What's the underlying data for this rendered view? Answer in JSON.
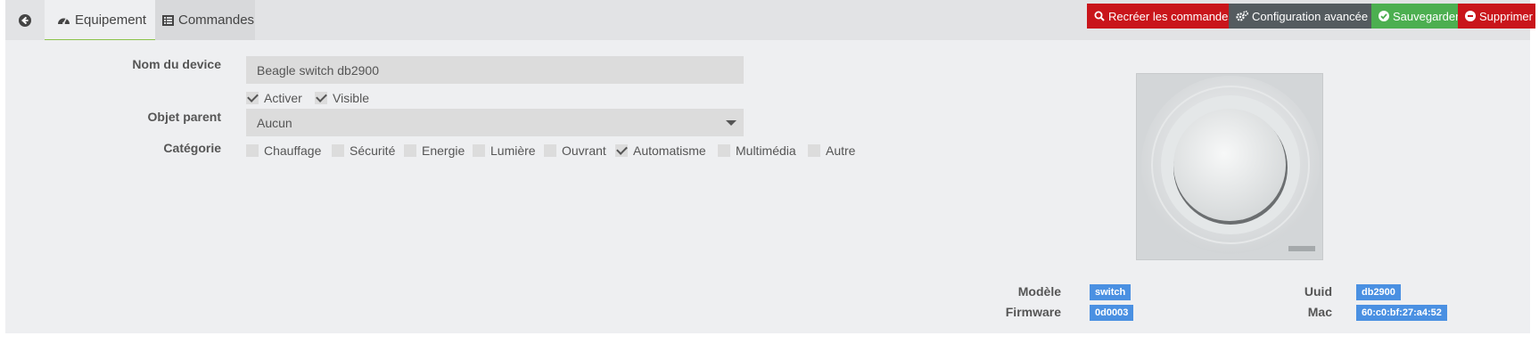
{
  "tabs": {
    "back_icon": "arrow-left-circle-icon",
    "equipment": {
      "label": "Equipement",
      "icon": "dashboard-icon"
    },
    "commands": {
      "label": "Commandes",
      "icon": "list-icon"
    }
  },
  "toolbar": {
    "recreate": {
      "label": "Recréer les commandes",
      "icon": "search-icon",
      "color": "#c9151b"
    },
    "advanced": {
      "label": "Configuration avancée",
      "icon": "cogs-icon",
      "color": "#545b5f"
    },
    "save": {
      "label": "Sauvegarder",
      "icon": "check-circle-icon",
      "color": "#4caf50"
    },
    "delete": {
      "label": "Supprimer",
      "icon": "minus-circle-icon",
      "color": "#c9151b"
    }
  },
  "form": {
    "name_label": "Nom du device",
    "name_value": "Beagle switch db2900",
    "enable_label": "Activer",
    "enable_checked": true,
    "visible_label": "Visible",
    "visible_checked": true,
    "parent_label": "Objet parent",
    "parent_value": "Aucun",
    "category_label": "Catégorie",
    "categories": [
      {
        "label": "Chauffage",
        "checked": false
      },
      {
        "label": "Sécurité",
        "checked": false
      },
      {
        "label": "Energie",
        "checked": false
      },
      {
        "label": "Lumière",
        "checked": false
      },
      {
        "label": "Ouvrant",
        "checked": false
      },
      {
        "label": "Automatisme",
        "checked": true
      },
      {
        "label": "Multimédia",
        "checked": false
      },
      {
        "label": "Autre",
        "checked": false
      }
    ]
  },
  "device_info": {
    "model_label": "Modèle",
    "model_value": "switch",
    "firmware_label": "Firmware",
    "firmware_value": "0d0003",
    "uuid_label": "Uuid",
    "uuid_value": "db2900",
    "mac_label": "Mac",
    "mac_value": "60:c0:bf:27:a4:52",
    "badge_color": "#4a90e2"
  }
}
